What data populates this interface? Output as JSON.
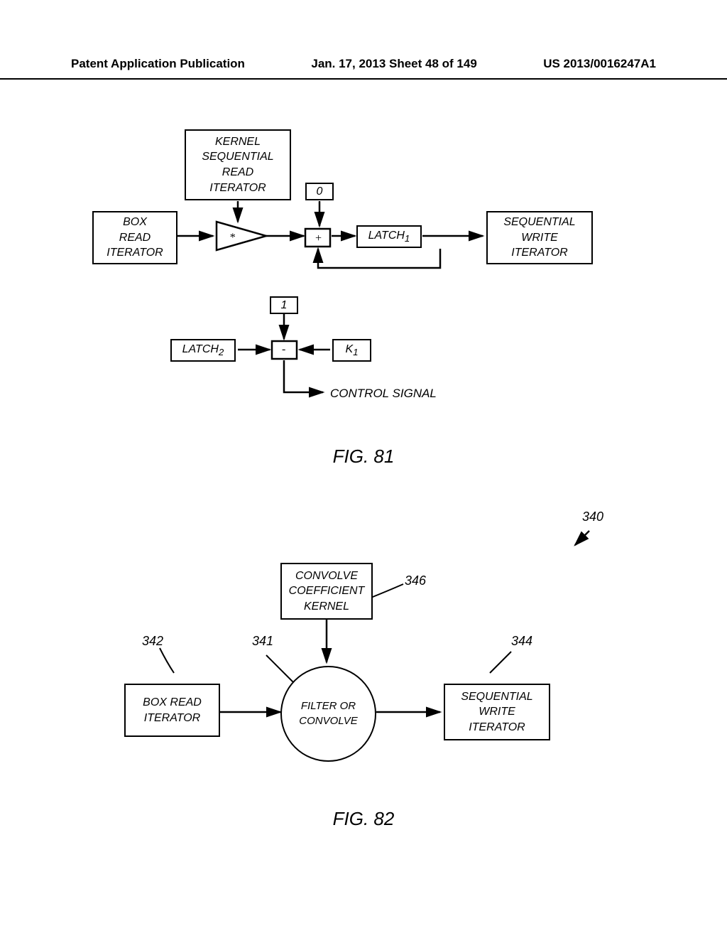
{
  "header": {
    "left": "Patent Application Publication",
    "center": "Jan. 17, 2013  Sheet 48 of 149",
    "right": "US 2013/0016247A1"
  },
  "fig81": {
    "kernel_box": "KERNEL\nSEQUENTIAL\nREAD\nITERATOR",
    "zero_box": "0",
    "box_read": "BOX\nREAD\nITERATOR",
    "multiply": "*",
    "plus": "+",
    "latch1": "LATCH",
    "latch1_sub": "1",
    "seq_write": "SEQUENTIAL\nWRITE\nITERATOR",
    "one_box": "1",
    "latch2": "LATCH",
    "latch2_sub": "2",
    "minus": "-",
    "k1": "K",
    "k1_sub": "1",
    "control_signal": "CONTROL SIGNAL",
    "caption": "FIG. 81"
  },
  "fig82": {
    "ref_340": "340",
    "convolve_box": "CONVOLVE\nCOEFFICIENT\nKERNEL",
    "ref_346": "346",
    "ref_342": "342",
    "ref_341": "341",
    "ref_344": "344",
    "box_read": "BOX READ\nITERATOR",
    "filter_circle": "FILTER OR\nCONVOLVE",
    "seq_write": "SEQUENTIAL\nWRITE\nITERATOR",
    "caption": "FIG. 82"
  }
}
